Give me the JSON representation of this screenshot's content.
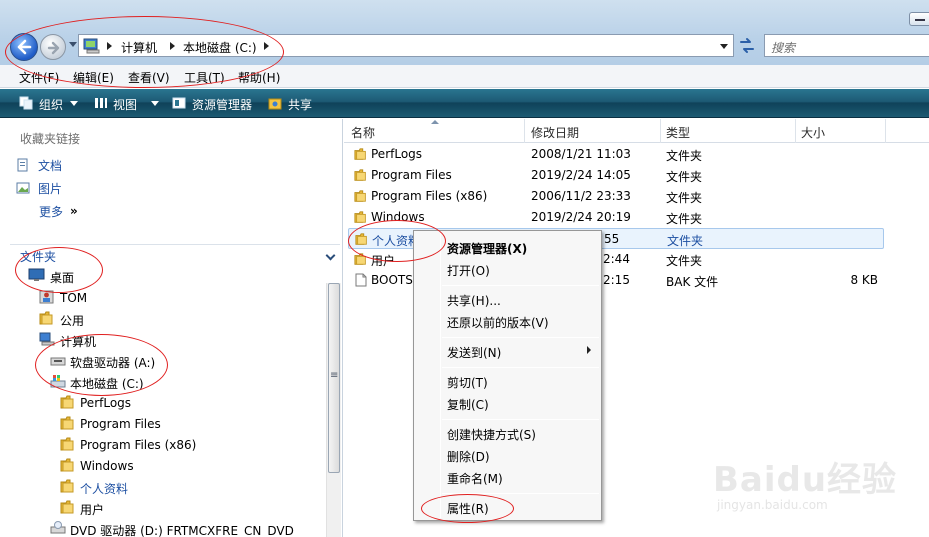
{
  "address_bar": {
    "crumbs": [
      "计算机",
      "本地磁盘 (C:)"
    ],
    "search_placeholder": "搜索"
  },
  "menubar": {
    "items": [
      "文件(F)",
      "编辑(E)",
      "查看(V)",
      "工具(T)",
      "帮助(H)"
    ]
  },
  "toolbar": {
    "organize": "组织",
    "views": "视图",
    "explorer": "资源管理器",
    "share": "共享"
  },
  "favorites": {
    "title": "收藏夹链接",
    "items": [
      "文档",
      "图片"
    ],
    "more": "更多"
  },
  "folders": {
    "title": "文件夹",
    "tree": [
      "桌面",
      "TOM",
      "公用",
      "计算机",
      "软盘驱动器 (A:)",
      "本地磁盘 (C:)",
      "PerfLogs",
      "Program Files",
      "Program Files (x86)",
      "Windows",
      "个人资料",
      "用户",
      "DVD 驱动器 (D:) FRTMCXFRE_CN_DVD"
    ]
  },
  "file_list": {
    "columns": [
      "名称",
      "修改日期",
      "类型",
      "大小"
    ],
    "rows": [
      {
        "name": "PerfLogs",
        "date": "2008/1/21 11:03",
        "type": "文件夹",
        "size": ""
      },
      {
        "name": "Program Files",
        "date": "2019/2/24 14:05",
        "type": "文件夹",
        "size": ""
      },
      {
        "name": "Program Files (x86)",
        "date": "2006/11/2 23:33",
        "type": "文件夹",
        "size": ""
      },
      {
        "name": "Windows",
        "date": "2019/2/24 20:19",
        "type": "文件夹",
        "size": ""
      },
      {
        "name": "个人资料",
        "date": "55",
        "type": "文件夹",
        "size": ""
      },
      {
        "name": "用户",
        "date": "2:44",
        "type": "文件夹",
        "size": ""
      },
      {
        "name": "BOOTS",
        "date": "2:15",
        "type": "BAK 文件",
        "size": "8 KB"
      }
    ]
  },
  "context_menu": {
    "items": [
      "资源管理器(X)",
      "打开(O)",
      "共享(H)...",
      "还原以前的版本(V)",
      "发送到(N)",
      "剪切(T)",
      "复制(C)",
      "创建快捷方式(S)",
      "删除(D)",
      "重命名(M)",
      "属性(R)"
    ]
  },
  "watermark": {
    "text": "Baidu经验",
    "url": "jingyan.baidu.com"
  },
  "colors": {
    "annotation": "#e02020",
    "link_blue": "#1e50a2",
    "toolbar": "#1d5a74"
  }
}
